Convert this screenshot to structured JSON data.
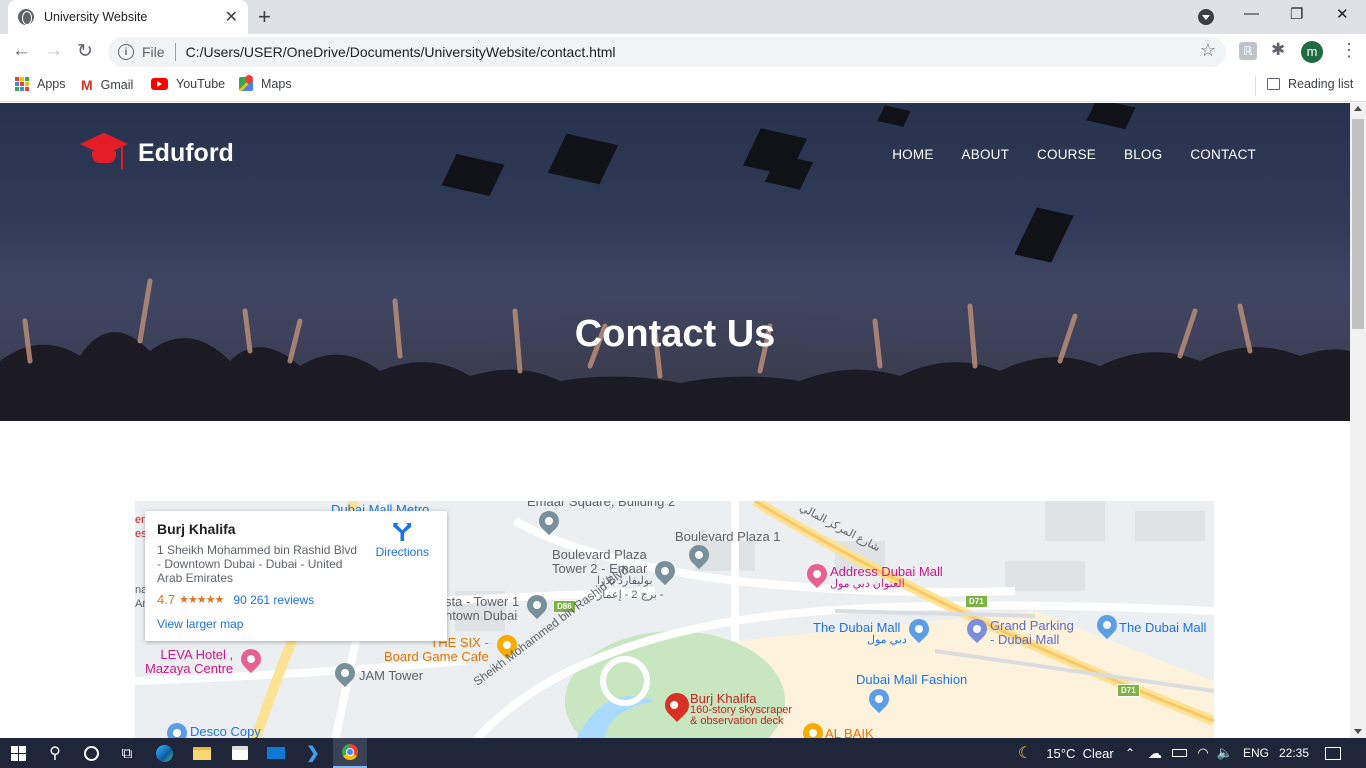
{
  "browser": {
    "tab_title": "University Website",
    "url_protocol": "File",
    "url": "C:/Users/USER/OneDrive/Documents/UniversityWebsite/contact.html",
    "profile_initial": "m",
    "bookmarks": [
      {
        "label": "Apps",
        "icon": "apps-grid-icon"
      },
      {
        "label": "Gmail",
        "icon": "gmail-icon"
      },
      {
        "label": "YouTube",
        "icon": "youtube-icon"
      },
      {
        "label": "Maps",
        "icon": "maps-icon"
      }
    ],
    "reading_list": "Reading list"
  },
  "site": {
    "brand": "Eduford",
    "brand_color": "#e51d26",
    "nav": [
      "HOME",
      "ABOUT",
      "COURSE",
      "BLOG",
      "CONTACT"
    ],
    "hero_title": "Contact Us"
  },
  "map": {
    "place_name": "Burj Khalifa",
    "address": "1 Sheikh Mohammed bin Rashid Blvd - Downtown Dubai - Dubai - United Arab Emirates",
    "rating": "4.7",
    "stars": "★★★★★",
    "reviews": "90 261 reviews",
    "view_larger": "View larger map",
    "directions": "Directions",
    "labels": {
      "dubai_mall_metro": "Dubai Mall Metro",
      "emaar_square": "Emaar Square, Building 2",
      "boulevard_plaza_1": "Boulevard Plaza 1",
      "boulevard_plaza_2": "Boulevard Plaza\nTower 2 - Emaar",
      "boulevard_plaza_2_ar": "بوليفارد بلازا\nبرج 2 - إعمار -",
      "address_dubai_mall": "Address Dubai Mall",
      "address_dubai_mall_ar": "العنوان دبي مول",
      "street_ar": "شارع المركز المالي",
      "vista_tower": "sta - Tower 1\nntown Dubai",
      "d86": "D86",
      "d71a": "D71",
      "d71b": "D71",
      "the_six": "THE SIX -\nBoard Game Cafe",
      "sheikh_blvd": "Sheikh Mohammed bin Rashid Blvd",
      "the_dubai_mall_1": "The Dubai Mall",
      "the_dubai_mall_1_ar": "دبي مول",
      "grand_parking": "Grand Parking\n- Dubai Mall",
      "the_dubai_mall_2": "The Dubai Mall",
      "leva_hotel": "LEVA Hotel ,\nMazaya Centre",
      "jam_tower": "JAM Tower",
      "dubai_mall_fashion": "Dubai Mall Fashion",
      "burj_khalifa_pin": "Burj Khalifa",
      "burj_khalifa_desc": "160-story skyscraper\n& observation deck",
      "desco_copy": "Desco Copy",
      "al_baik": "AL BAIK",
      "edge_left": "em\nes",
      "edge_left_2": "na\nAr"
    }
  },
  "taskbar": {
    "weather": "15°C  Clear",
    "lang": "ENG",
    "time": "22:35"
  }
}
